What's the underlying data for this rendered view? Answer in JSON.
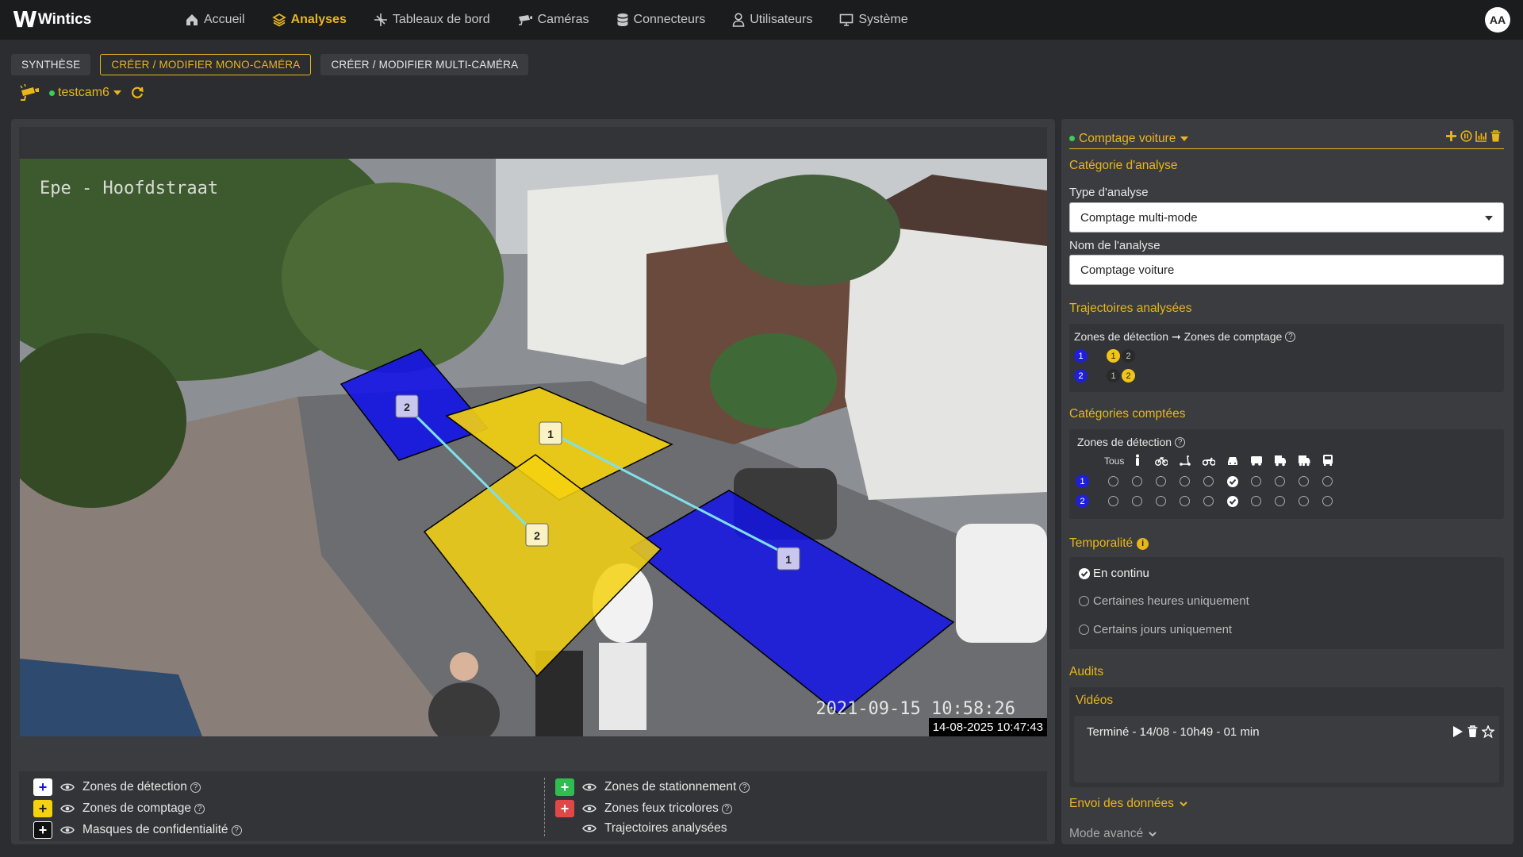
{
  "app": {
    "name": "Wintics",
    "avatar": "AA"
  },
  "nav": [
    {
      "label": "Accueil",
      "icon": "home-icon"
    },
    {
      "label": "Analyses",
      "icon": "layers-icon",
      "active": true
    },
    {
      "label": "Tableaux de bord",
      "icon": "dashboard-icon"
    },
    {
      "label": "Caméras",
      "icon": "camera-icon"
    },
    {
      "label": "Connecteurs",
      "icon": "database-icon"
    },
    {
      "label": "Utilisateurs",
      "icon": "user-icon"
    },
    {
      "label": "Système",
      "icon": "monitor-icon"
    }
  ],
  "tabs": {
    "synthese": "SYNTHÈSE",
    "mono": "CRÉER / MODIFIER MONO-CAMÉRA",
    "multi": "CRÉER / MODIFIER MULTI-CAMÉRA"
  },
  "camera": {
    "name": "testcam6",
    "status_color": "#3bcc5b"
  },
  "video": {
    "overlay_title": "Epe - Hoofdstraat",
    "overlay_time": "2021-09-15 10:58:26",
    "timestamp": "14-08-2025 10:47:43"
  },
  "zones": {
    "detection_color": "#1414e6",
    "counting_color": "#f5d20f",
    "trajectory_color": "#7fe0e8",
    "labels": {
      "d1": "1",
      "d2": "2",
      "c1": "1",
      "c2": "2"
    }
  },
  "legend": {
    "detection": "Zones de détection",
    "counting": "Zones de comptage",
    "privacy": "Masques de confidentialité",
    "parking": "Zones de stationnement",
    "lights": "Zones feux tricolores",
    "trajectories": "Trajectoires analysées"
  },
  "analysis": {
    "title": "Comptage voiture",
    "category_title": "Catégorie d'analyse",
    "type_label": "Type d'analyse",
    "type_value": "Comptage multi-mode",
    "name_label": "Nom de l'analyse",
    "name_value": "Comptage voiture",
    "traj_title": "Trajectoires analysées",
    "traj_header": "Zones de détection ➞ Zones de comptage",
    "traj_rows": [
      {
        "det": "1",
        "counts": [
          "1",
          "2"
        ],
        "active": 0
      },
      {
        "det": "2",
        "counts": [
          "1",
          "2"
        ],
        "active": 1
      }
    ],
    "cat_title": "Catégories comptées",
    "cat_header": "Zones de détection",
    "cat_all": "Tous",
    "cat_icons": [
      "pedestrian-icon",
      "bicycle-icon",
      "scooter-icon",
      "motorcycle-icon",
      "car-icon",
      "van-icon",
      "truck-icon",
      "heavy-truck-icon",
      "bus-icon"
    ],
    "cat_rows": [
      {
        "det": "1",
        "checked": 5
      },
      {
        "det": "2",
        "checked": 5
      }
    ],
    "temp_title": "Temporalité",
    "temp_options": [
      "En continu",
      "Certaines heures uniquement",
      "Certains jours uniquement"
    ],
    "temp_selected": 0,
    "audits_title": "Audits",
    "videos_title": "Vidéos",
    "video_item": "Terminé - 14/08 - 10h49 - 01 min",
    "send_title": "Envoi des données",
    "advanced_title": "Mode avancé"
  },
  "colors": {
    "accent": "#e8b61c",
    "status_ok": "#3bcc5b",
    "add_green": "#2ebd4e",
    "add_red": "#e04848"
  }
}
